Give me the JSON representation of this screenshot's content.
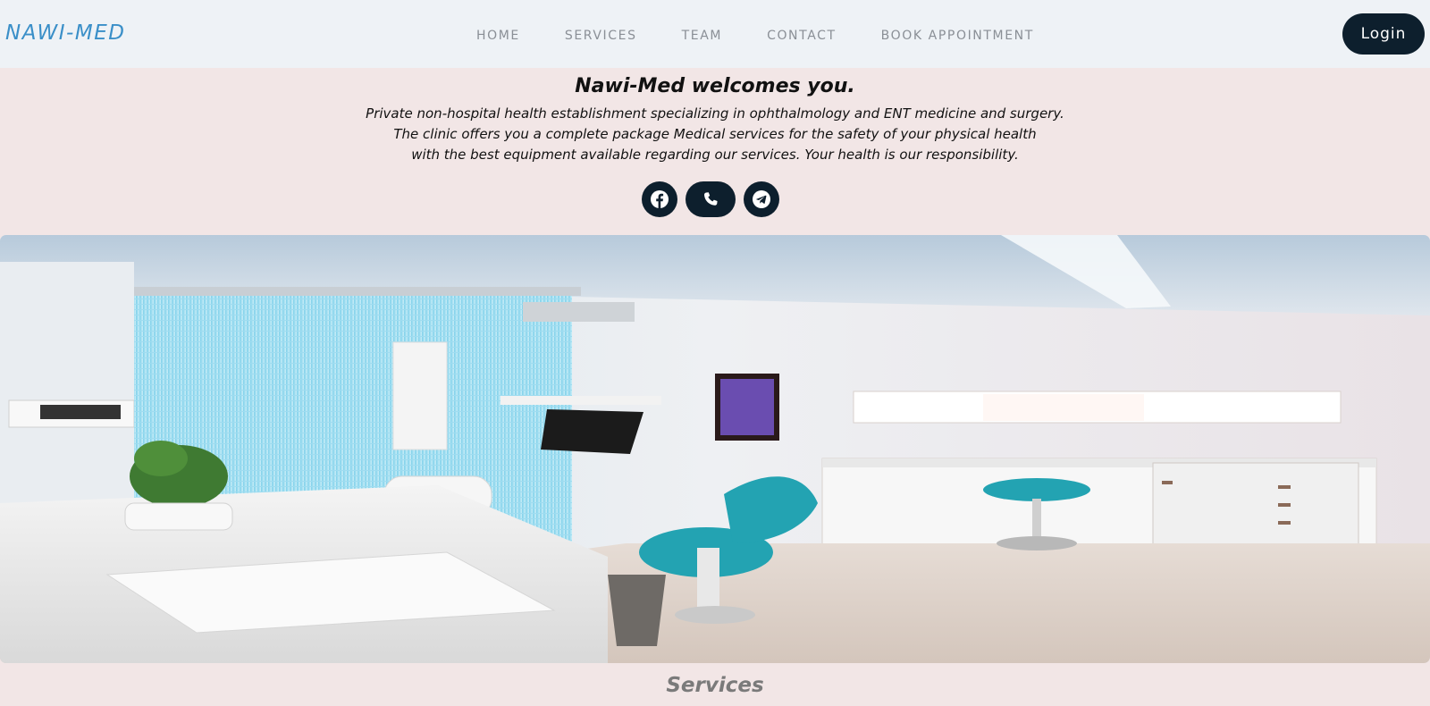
{
  "brand": {
    "name": "NAWI-MED",
    "color": "#3a8fc8"
  },
  "nav": {
    "items": [
      {
        "label": "HOME"
      },
      {
        "label": "SERVICES"
      },
      {
        "label": "TEAM"
      },
      {
        "label": "CONTACT"
      },
      {
        "label": "BOOK APPOINTMENT"
      }
    ],
    "login_label": "Login"
  },
  "welcome": {
    "title": "Nawi-Med welcomes you.",
    "lines": [
      "Private non-hospital health establishment specializing in ophthalmology and ENT medicine and surgery.",
      "The clinic offers you a complete package Medical services for the safety of your physical health",
      "with the best equipment available regarding our services. Your health is our responsibility."
    ]
  },
  "social": [
    {
      "icon": "facebook-icon"
    },
    {
      "icon": "phone-icon"
    },
    {
      "icon": "telegram-icon"
    }
  ],
  "hero": {
    "image": "dental-clinic-photo"
  },
  "services": {
    "title": "Services"
  },
  "colors": {
    "header_bg": "#eef2f6",
    "page_bg": "#f2e6e6",
    "button_dark": "#0d1f2d",
    "nav_text": "#8a8f96"
  }
}
